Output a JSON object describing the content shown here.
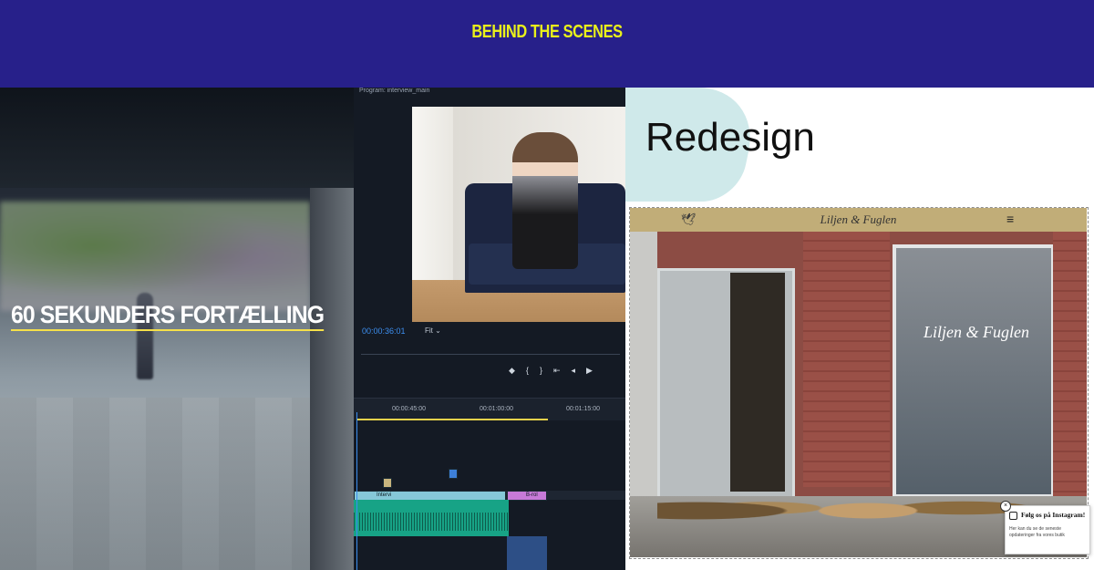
{
  "header": {
    "title": "BEHIND THE SCENES",
    "bg": "#27208a",
    "accent": "#e9f01b"
  },
  "video_panel": {
    "title": "60 SEKUNDERS FORTÆLLING"
  },
  "editor": {
    "program_label": "Program: interview_main",
    "timecode": "00:00:36:01",
    "zoom": "Fit",
    "transport_icons": [
      "marker-icon",
      "mark-in-icon",
      "mark-out-icon",
      "go-to-in-icon",
      "step-back-icon",
      "play-icon"
    ],
    "ruler": [
      "00:00:45:00",
      "00:01:00:00",
      "00:01:15:00"
    ],
    "clips": [
      "Intervi",
      "B-rol"
    ],
    "colors": {
      "timecode": "#3d8ff0",
      "audio": "#17a386",
      "playhead": "#3d8ff0"
    }
  },
  "redesign": {
    "heading": "Redesign",
    "site_logo": "Liljen & Fuglen",
    "shop_sign": "Liljen & Fuglen",
    "popup": {
      "title": "Følg os på Instagram!",
      "text": "Her kan du se de seneste opdateringer fra vores butik"
    }
  }
}
